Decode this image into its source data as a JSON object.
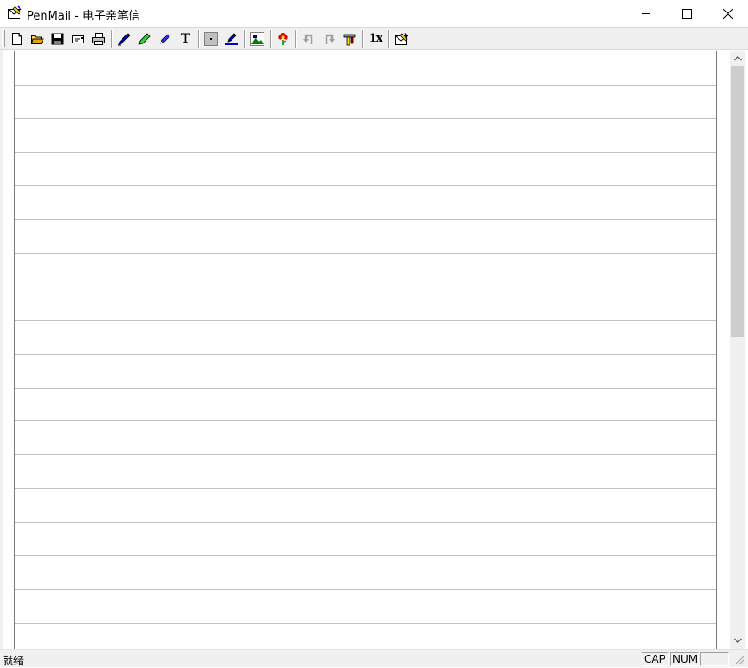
{
  "window": {
    "title": "PenMail - 电子亲笔信"
  },
  "toolbar": {
    "buttons": [
      {
        "name": "new-document",
        "icon": "new-page-icon"
      },
      {
        "name": "open",
        "icon": "folder-open-icon"
      },
      {
        "name": "save",
        "icon": "floppy-disk-icon"
      },
      {
        "name": "envelope",
        "icon": "envelope-icon"
      },
      {
        "name": "print",
        "icon": "printer-icon"
      },
      {
        "name": "pen",
        "icon": "pen-icon"
      },
      {
        "name": "highlighter",
        "icon": "highlighter-icon"
      },
      {
        "name": "eraser",
        "icon": "eraser-icon"
      },
      {
        "name": "text",
        "icon": "text-icon",
        "glyph": "T"
      },
      {
        "name": "pen-width",
        "icon": "dot-icon"
      },
      {
        "name": "pen-color",
        "icon": "pen-color-icon"
      },
      {
        "name": "background",
        "icon": "background-image-icon"
      },
      {
        "name": "stamp",
        "icon": "flower-icon"
      },
      {
        "name": "undo",
        "icon": "undo-icon",
        "disabled": true
      },
      {
        "name": "redo",
        "icon": "redo-icon",
        "disabled": true
      },
      {
        "name": "tools",
        "icon": "tools-icon"
      },
      {
        "name": "zoom",
        "icon": "zoom-1x-icon",
        "glyph": "1x"
      },
      {
        "name": "send-mail",
        "icon": "mail-send-icon"
      }
    ]
  },
  "paper": {
    "line_color": "#c0c0c0"
  },
  "status": {
    "text": "就绪",
    "cap": "CAP",
    "num": "NUM",
    "extra": ""
  },
  "colors": {
    "chrome": "#f0f0f0",
    "accent_blue": "#0000cc"
  }
}
